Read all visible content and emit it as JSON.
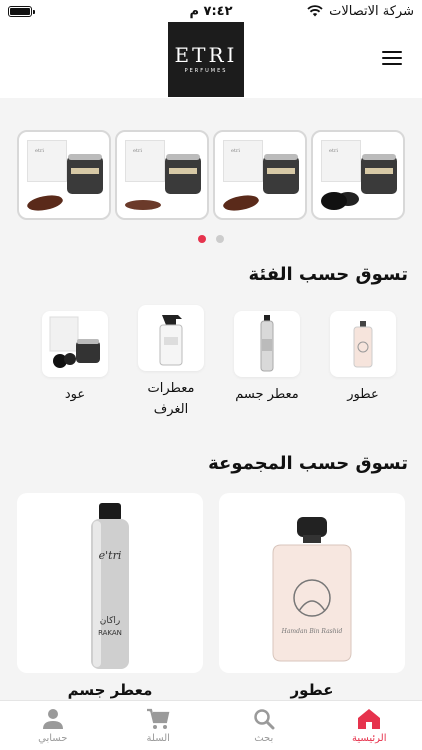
{
  "status_bar": {
    "carrier": "شركة الاتصالات",
    "time": "٧:٤٢ م"
  },
  "header": {
    "logo_main": "ETRI",
    "logo_sub": "PERFUMES"
  },
  "banner": {
    "slides": [
      {
        "box_label": "etri",
        "item": "black-balls"
      },
      {
        "box_label": "etri",
        "item": "oud-wood"
      },
      {
        "box_label": "etri",
        "item": "powder"
      },
      {
        "box_label": "etri",
        "item": "oud-wood"
      }
    ],
    "active_dot": 0,
    "dot_count": 2
  },
  "shop_by_category": {
    "title": "تسوق حسب الفئة",
    "items": [
      {
        "label": "عطور",
        "icon": "perfume-bottle-icon"
      },
      {
        "label": "معطر جسم",
        "icon": "body-spray-icon"
      },
      {
        "label": "معطرات الغرف",
        "icon": "room-spray-icon"
      },
      {
        "label": "عود",
        "icon": "oud-jar-icon"
      }
    ]
  },
  "shop_by_collection": {
    "title": "تسوق حسب المجموعة",
    "items": [
      {
        "label": "عطور"
      },
      {
        "label": "معطر جسم"
      }
    ],
    "perfume_bottle_text": "Hamdan Bin Rashid",
    "spray_brand": "e'tri",
    "spray_name_ar": "راكان",
    "spray_name_en": "RAKAN"
  },
  "bottom_nav": {
    "items": [
      {
        "label": "الرئيسية",
        "icon": "home-icon",
        "active": true
      },
      {
        "label": "بحث",
        "icon": "search-icon",
        "active": false
      },
      {
        "label": "السلة",
        "icon": "cart-icon",
        "active": false
      },
      {
        "label": "حسابي",
        "icon": "user-icon",
        "active": false
      }
    ]
  },
  "colors": {
    "accent": "#e6334d",
    "background": "#f4f4f4",
    "logo_bg": "#1c1c1c"
  }
}
